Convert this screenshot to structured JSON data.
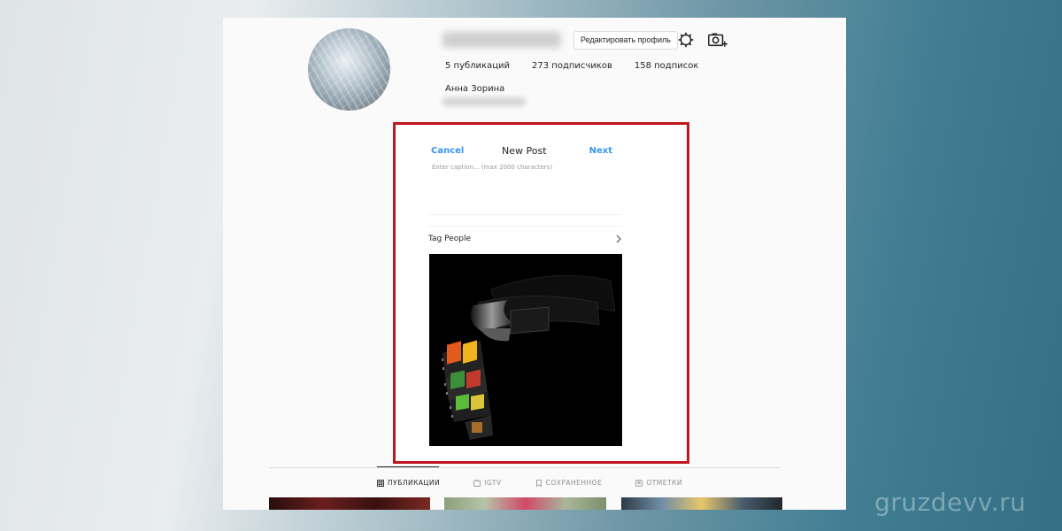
{
  "profile": {
    "edit_button": "Редактировать профиль",
    "stats": {
      "posts": "5 публикаций",
      "followers": "273 подписчиков",
      "following": "158 подписок"
    },
    "full_name": "Анна Зорина"
  },
  "new_post": {
    "cancel": "Cancel",
    "title": "New Post",
    "next": "Next",
    "caption_placeholder": "Enter caption... (max 2000 characters)",
    "tag_people": "Tag People"
  },
  "tabs": [
    {
      "label": "ПУБЛИКАЦИИ",
      "icon": "grid-icon",
      "active": true
    },
    {
      "label": "IGTV",
      "icon": "igtv-icon",
      "active": false
    },
    {
      "label": "СОХРАНЕННОЕ",
      "icon": "bookmark-icon",
      "active": false
    },
    {
      "label": "ОТМЕТКИ",
      "icon": "tagged-icon",
      "active": false
    }
  ],
  "watermark": "gruzdevv.ru",
  "colors": {
    "link": "#3897f0",
    "highlight": "#c0161d"
  }
}
